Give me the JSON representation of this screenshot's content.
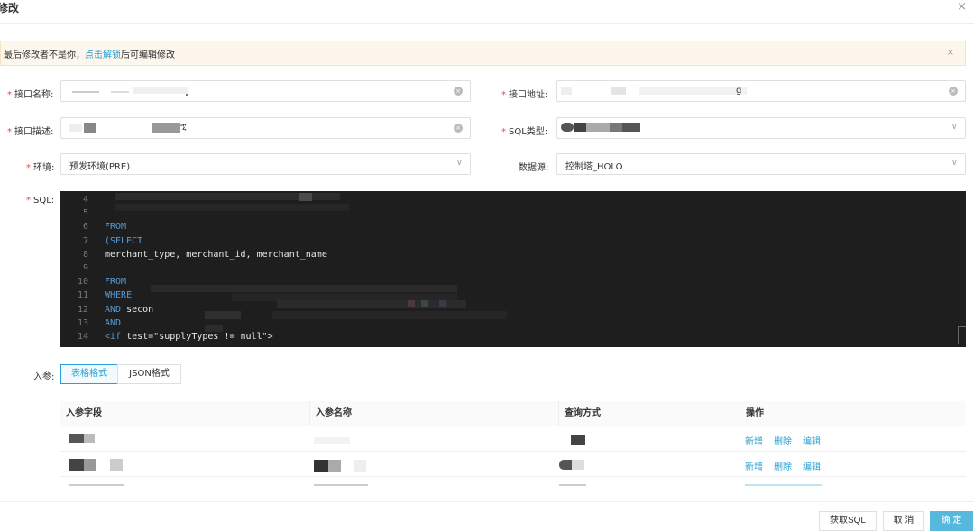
{
  "dialog": {
    "title": "修改",
    "close_icon": "×"
  },
  "notice": {
    "prefix": "最后修改者不是你，",
    "link": "点击解锁",
    "suffix": "后可编辑修改",
    "close_icon": "×"
  },
  "form": {
    "required_mark": "*",
    "api_name_label": "接口名称:",
    "api_address_label": "接口地址:",
    "api_address_value_tail": "g",
    "api_desc_label": "接口描述:",
    "api_desc_value_tail": "ኚ",
    "sql_type_label": "SQL类型:",
    "env_label": "环境:",
    "env_value": "预发环境(PRE)",
    "datasource_label": "数据源:",
    "datasource_value": "控制塔_HOLO",
    "sql_label": "SQL:"
  },
  "sql_lines": [
    {
      "num": "4",
      "parts": []
    },
    {
      "num": "5",
      "parts": []
    },
    {
      "num": "6",
      "parts": [
        {
          "t": "FROM",
          "c": "kw"
        }
      ]
    },
    {
      "num": "7",
      "parts": [
        {
          "t": "(SELECT",
          "c": "kw"
        }
      ]
    },
    {
      "num": "8",
      "parts": [
        {
          "t": "merchant_type, merchant_id, merchant_name",
          "c": "str"
        }
      ]
    },
    {
      "num": "9",
      "parts": []
    },
    {
      "num": "10",
      "parts": [
        {
          "t": "FROM",
          "c": "kw"
        }
      ]
    },
    {
      "num": "11",
      "parts": [
        {
          "t": "WHERE",
          "c": "kw"
        }
      ]
    },
    {
      "num": "12",
      "parts": [
        {
          "t": "AND",
          "c": "kw"
        },
        {
          "t": " secon",
          "c": "str"
        }
      ]
    },
    {
      "num": "13",
      "parts": [
        {
          "t": "AND",
          "c": "kw"
        }
      ]
    },
    {
      "num": "14",
      "parts": [
        {
          "t": "<if",
          "c": "tag"
        },
        {
          "t": " test=\"supplyTypes != null\">",
          "c": "str"
        }
      ]
    }
  ],
  "params": {
    "label": "入参:",
    "tabs": [
      "表格格式",
      "JSON格式"
    ],
    "columns": [
      "入参字段",
      "入参名称",
      "查询方式",
      "操作"
    ],
    "row_ops": [
      "新增",
      "删除",
      "编辑"
    ]
  },
  "footer": {
    "get_sql": "获取SQL",
    "cancel": "取 消",
    "confirm": "确 定"
  }
}
